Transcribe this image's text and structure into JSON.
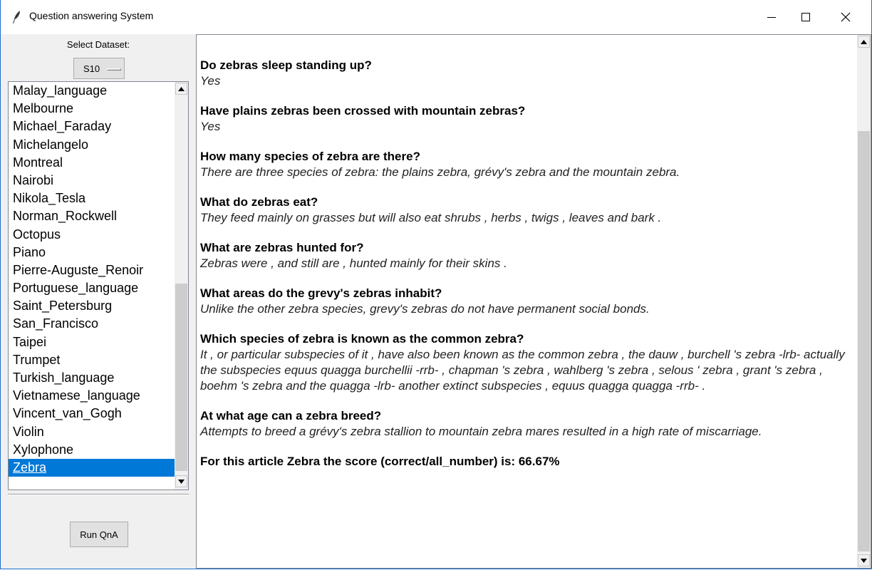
{
  "window": {
    "title": "Question answering System"
  },
  "left_panel": {
    "dataset_label": "Select Dataset:",
    "dataset_value": "S10",
    "articles": [
      "Malay_language",
      "Melbourne",
      "Michael_Faraday",
      "Michelangelo",
      "Montreal",
      "Nairobi",
      "Nikola_Tesla",
      "Norman_Rockwell",
      "Octopus",
      "Piano",
      "Pierre-Auguste_Renoir",
      "Portuguese_language",
      "Saint_Petersburg",
      "San_Francisco",
      "Taipei",
      "Trumpet",
      "Turkish_language",
      "Vietnamese_language",
      "Vincent_van_Gogh",
      "Violin",
      "Xylophone",
      "Zebra"
    ],
    "selected_article": "Zebra",
    "run_button": "Run QnA"
  },
  "results": {
    "qa": [
      {
        "question": "Do zebras sleep standing up?",
        "answer": "Yes"
      },
      {
        "question": "Have plains zebras been crossed with mountain zebras?",
        "answer": "Yes"
      },
      {
        "question": "How many species of zebra are there?",
        "answer": "There are three species of zebra: the plains zebra, grévy's zebra and the mountain zebra."
      },
      {
        "question": "What do zebras eat?",
        "answer": "They feed mainly on grasses but will also eat shrubs , herbs , twigs , leaves and bark ."
      },
      {
        "question": "What are zebras hunted for?",
        "answer": "Zebras were , and still are , hunted mainly for their skins ."
      },
      {
        "question": "What areas do the grevy's zebras inhabit?",
        "answer": "Unlike the other zebra species, grevy's zebras do not have permanent social bonds."
      },
      {
        "question": "Which species of zebra is known as the common zebra?",
        "answer": "It , or particular subspecies of it , have also been known as the common zebra , the dauw , burchell 's zebra -lrb- actually the subspecies equus quagga burchellii -rrb- , chapman 's zebra , wahlberg 's zebra , selous ' zebra , grant 's zebra , boehm 's zebra and the quagga -lrb- another extinct subspecies , equus quagga quagga -rrb- ."
      },
      {
        "question": "At what age can a zebra breed?",
        "answer": "Attempts to breed a grévy's zebra stallion to mountain zebra mares resulted in a high rate of miscarriage."
      }
    ],
    "score_text": "For this article Zebra the score (correct/all_number) is: 66.67%"
  }
}
